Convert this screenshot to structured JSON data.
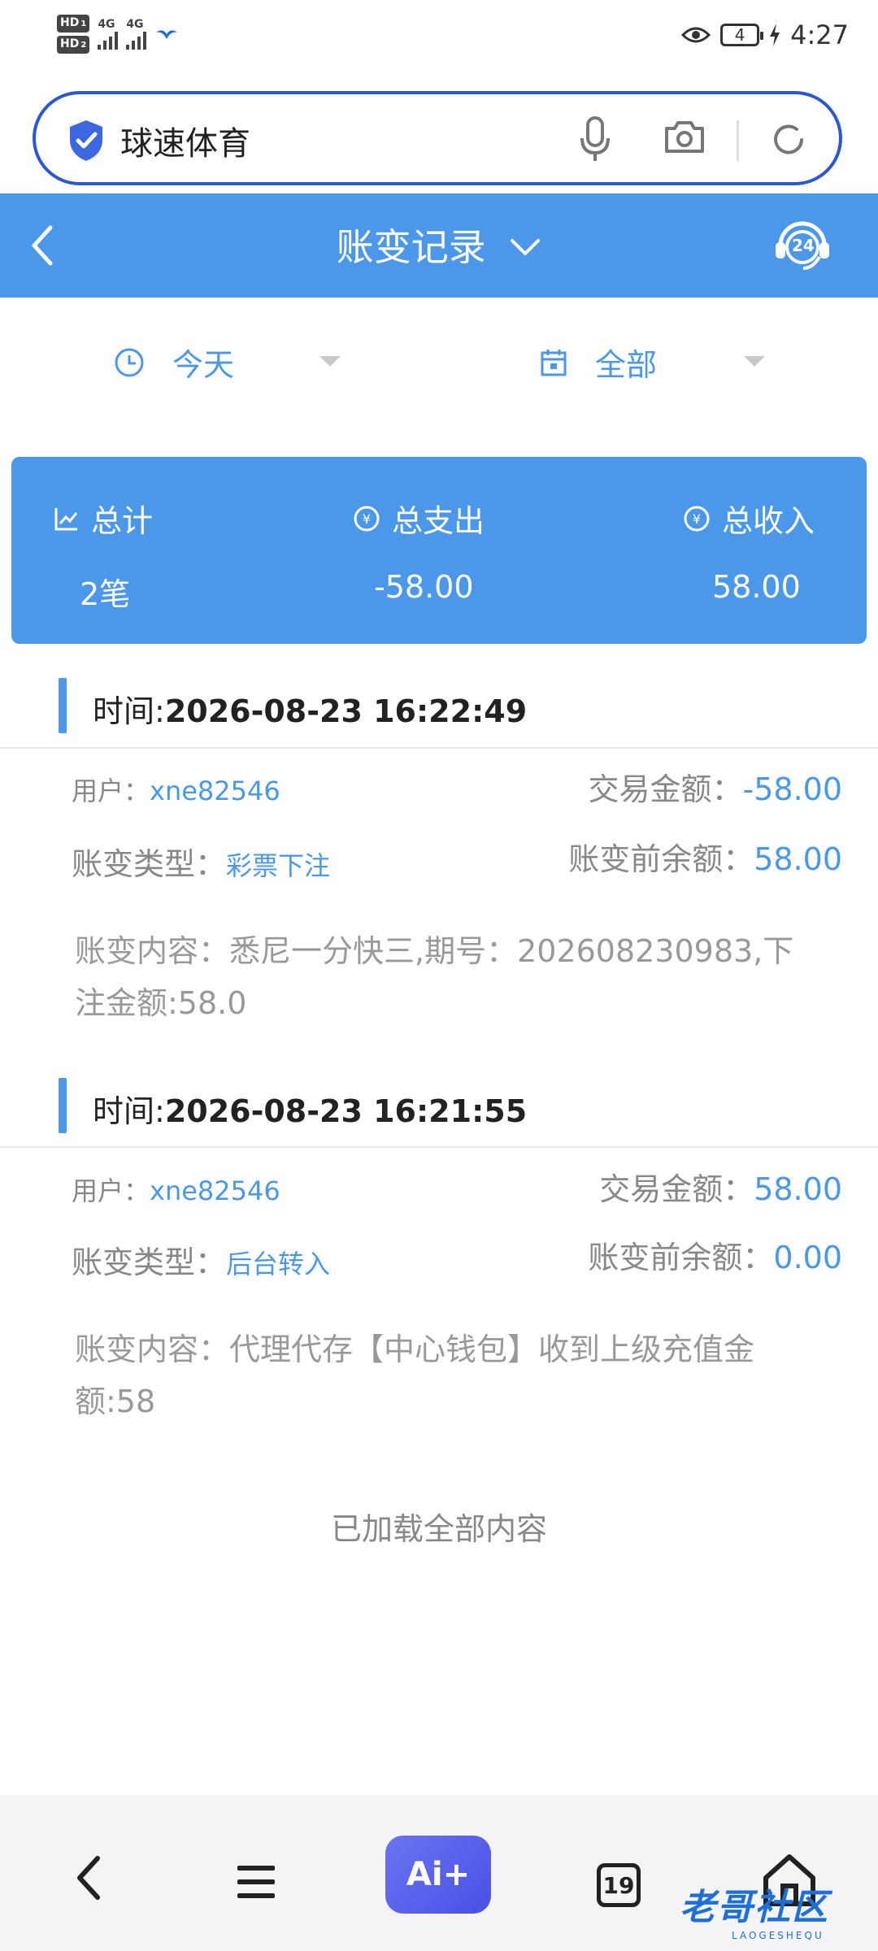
{
  "status_bar": {
    "hd1": "HD",
    "hd1_sub": "1",
    "hd2": "HD",
    "hd2_sub": "2",
    "net1": "4G",
    "net2": "4G",
    "battery": "4",
    "time": "4:27"
  },
  "search": {
    "query": "球速体育"
  },
  "header": {
    "title": "账变记录",
    "support_badge": "24"
  },
  "filters": {
    "date": "今天",
    "type": "全部"
  },
  "summary": {
    "total_label": "总计",
    "total_value": "2笔",
    "expense_label": "总支出",
    "expense_value": "-58.00",
    "income_label": "总收入",
    "income_value": "58.00"
  },
  "records": [
    {
      "time_label": "时间:",
      "time": "2026-08-23 16:22:49",
      "user_label": "用户：",
      "user": "xne82546",
      "amount_label": "交易金额：",
      "amount": "-58.00",
      "type_label": "账变类型：",
      "type": "彩票下注",
      "balance_label": "账变前余额：",
      "balance": "58.00",
      "content_label": "账变内容：",
      "content": "悉尼一分快三,期号：202608230983,下注金额:58.0"
    },
    {
      "time_label": "时间:",
      "time": "2026-08-23 16:21:55",
      "user_label": "用户：",
      "user": "xne82546",
      "amount_label": "交易金额：",
      "amount": "58.00",
      "type_label": "账变类型：",
      "type": "后台转入",
      "balance_label": "账变前余额：",
      "balance": "0.00",
      "content_label": "账变内容：",
      "content": "代理代存【中心钱包】收到上级充值金额:58"
    }
  ],
  "footer": {
    "loaded_text": "已加载全部内容"
  },
  "bottom_nav": {
    "ai_label": "Ai+",
    "tabs_count": "19",
    "watermark": "老哥社区",
    "watermark_sub": "LAOGESHEQU"
  },
  "colors": {
    "accent": "#4b97ea",
    "search_border": "#2a57d6"
  }
}
